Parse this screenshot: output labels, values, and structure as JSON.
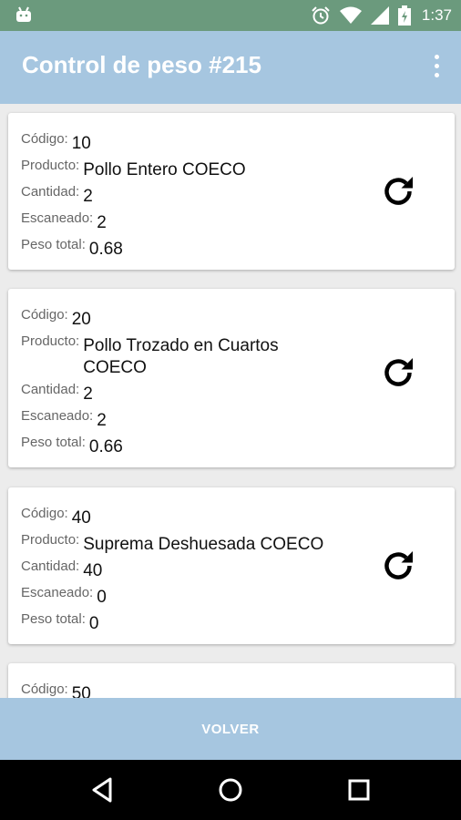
{
  "status_bar": {
    "time": "1:37",
    "icons": [
      "android-icon",
      "alarm-icon",
      "wifi-icon",
      "signal-icon",
      "battery-icon"
    ]
  },
  "app_bar": {
    "title": "Control de peso #215",
    "menu_icon": "overflow-menu-icon"
  },
  "labels": {
    "codigo": "Código:",
    "producto": "Producto:",
    "cantidad": "Cantidad:",
    "escaneado": "Escaneado:",
    "peso_total": "Peso total:"
  },
  "items": [
    {
      "codigo": "10",
      "producto": "Pollo Entero COECO",
      "cantidad": "2",
      "escaneado": "2",
      "peso_total": "0.68"
    },
    {
      "codigo": "20",
      "producto": "Pollo Trozado en Cuartos COECO",
      "cantidad": "2",
      "escaneado": "2",
      "peso_total": "0.66"
    },
    {
      "codigo": "40",
      "producto": "Suprema Deshuesada COECO",
      "cantidad": "40",
      "escaneado": "0",
      "peso_total": "0"
    },
    {
      "codigo": "50"
    }
  ],
  "bottom_button": {
    "label": "VOLVER"
  },
  "colors": {
    "status_bar": "#6b9a7d",
    "app_bar": "#a6c6e0",
    "background": "#ececec"
  }
}
